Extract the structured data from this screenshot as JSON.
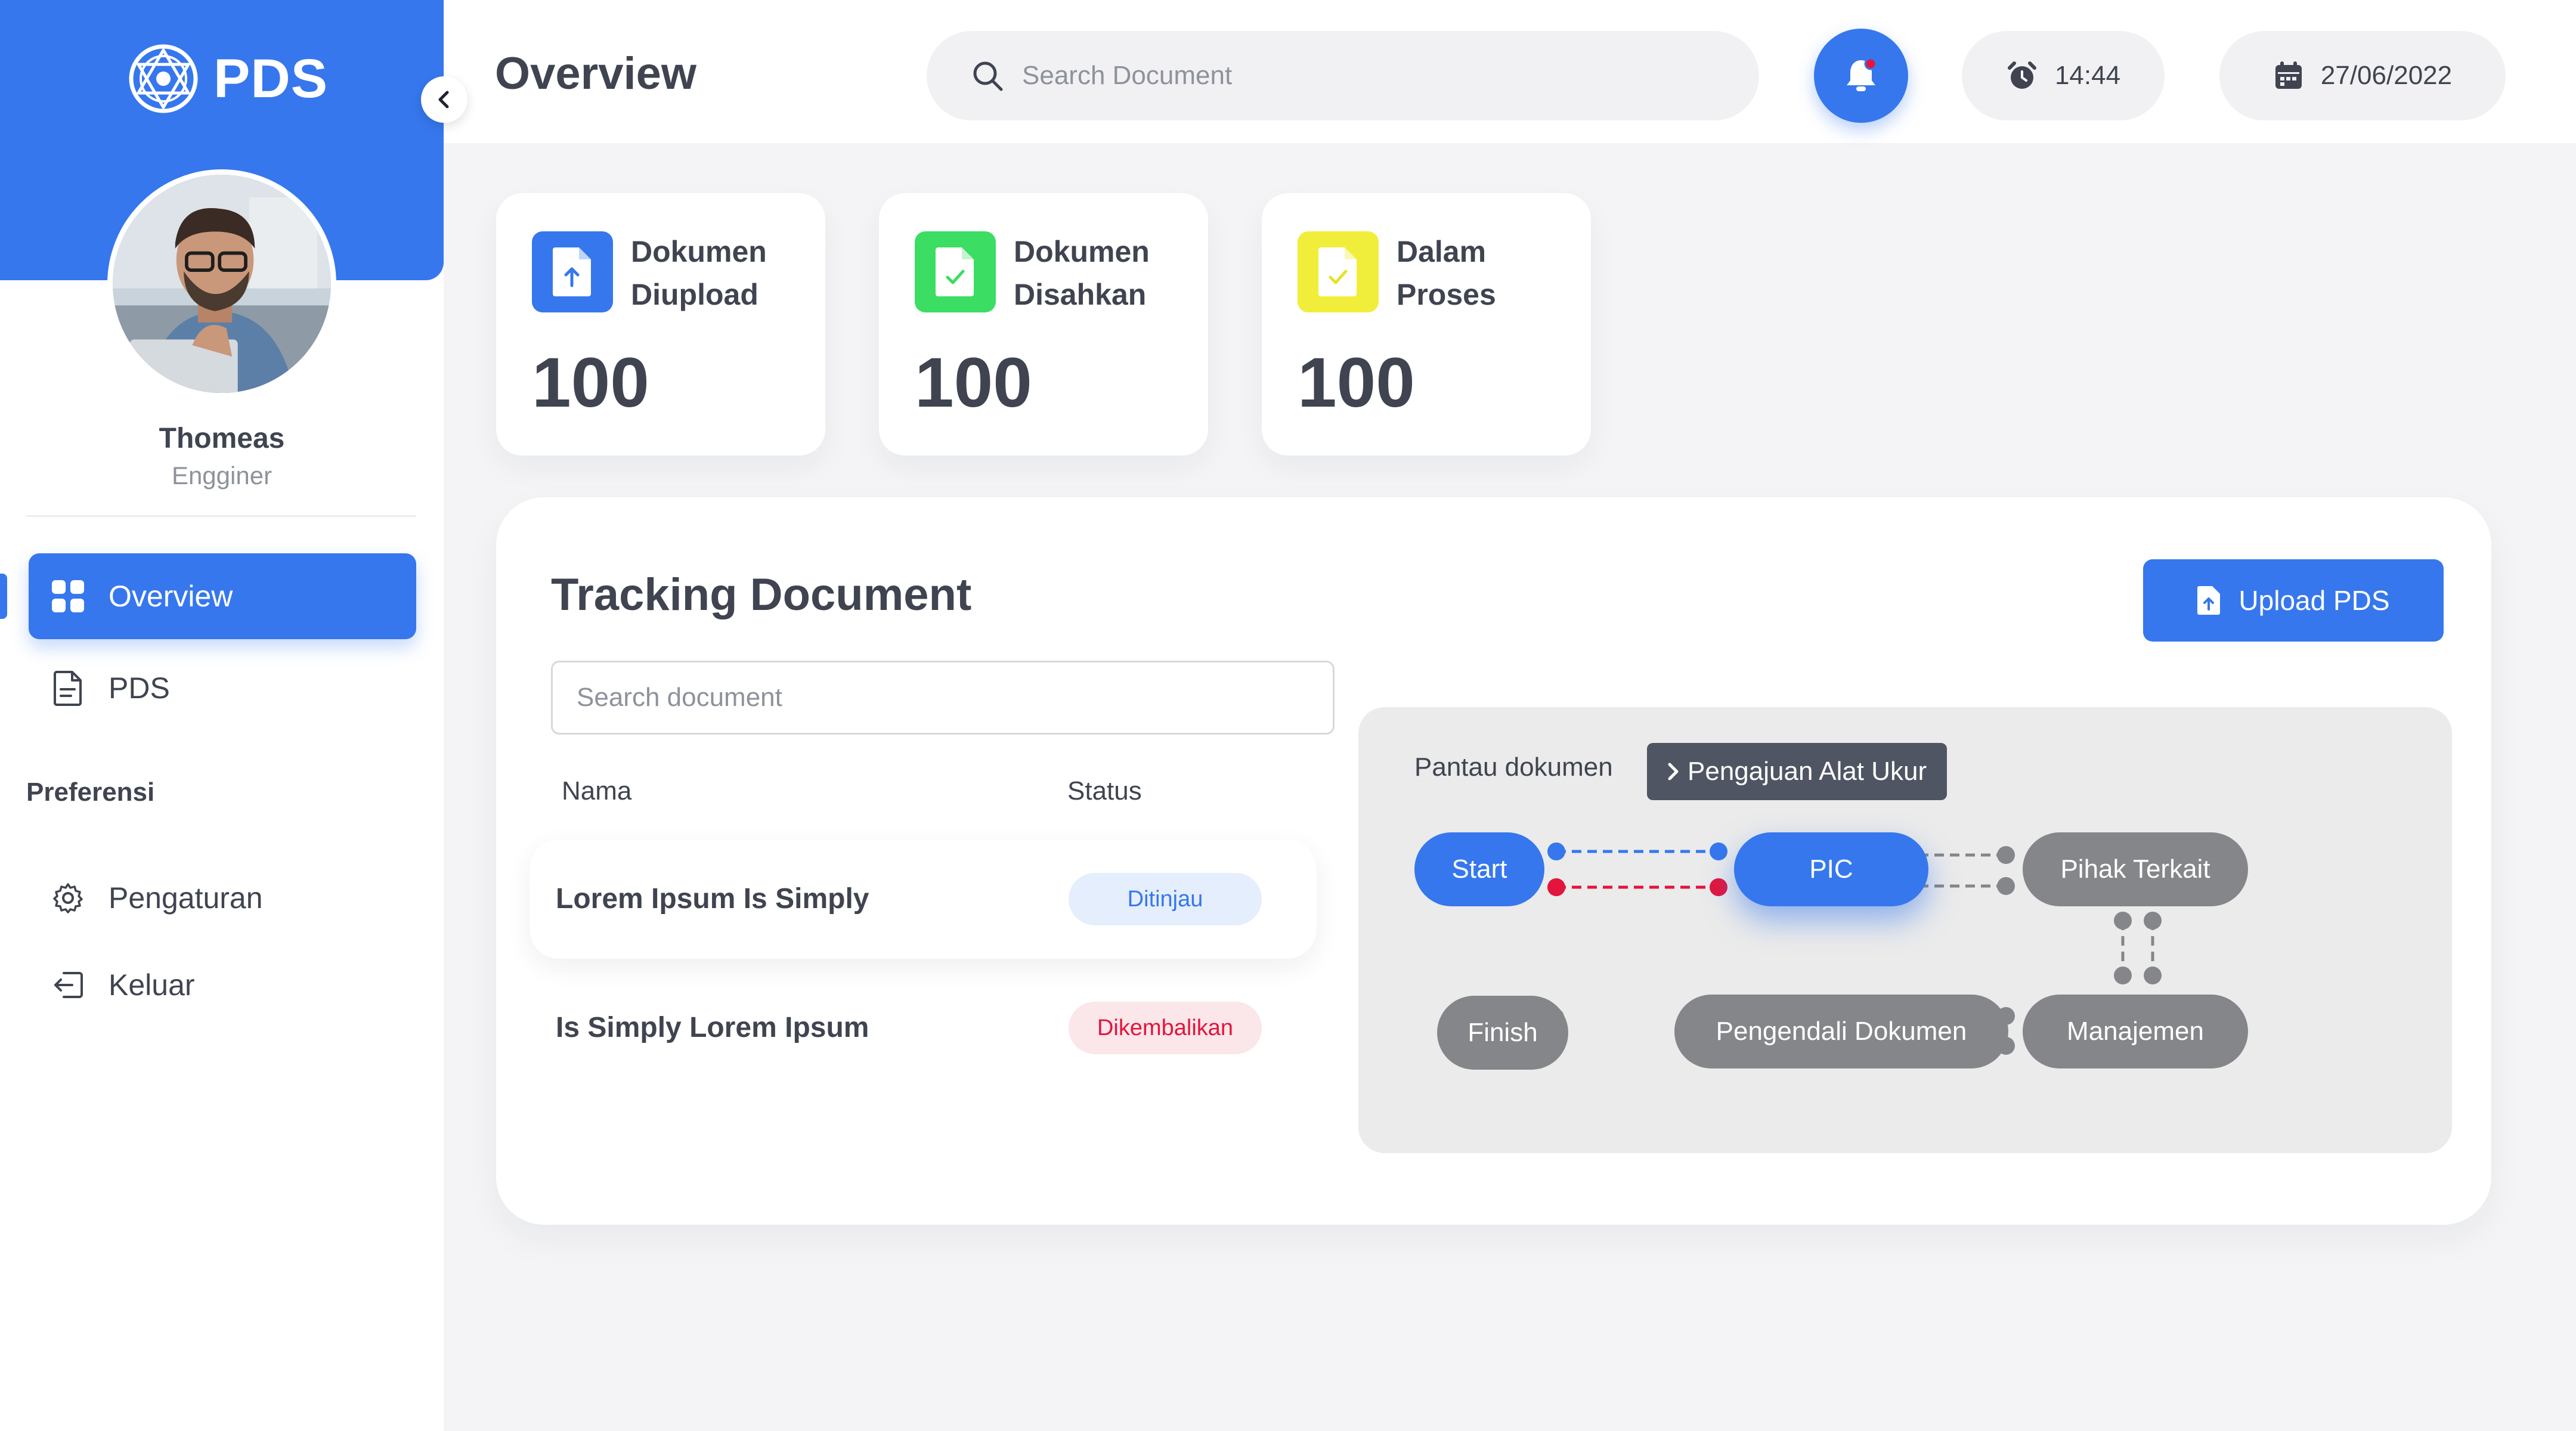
{
  "sidebar": {
    "brand": "PDS",
    "user": {
      "name": "Thomeas",
      "role": "Engginer"
    },
    "nav": [
      {
        "label": "Overview",
        "icon": "grid-icon",
        "active": true
      },
      {
        "label": "PDS",
        "icon": "document-icon",
        "active": false
      }
    ],
    "preferences_title": "Preferensi",
    "preferences": [
      {
        "label": "Pengaturan",
        "icon": "gear-icon"
      },
      {
        "label": "Keluar",
        "icon": "logout-icon"
      }
    ]
  },
  "header": {
    "title": "Overview",
    "search_placeholder": "Search Document",
    "time": "14:44",
    "date": "27/06/2022"
  },
  "stats": [
    {
      "label": "Dokumen Diupload",
      "value": "100",
      "color": "#3677EE",
      "icon": "file-upload-icon"
    },
    {
      "label": "Dokumen Disahkan",
      "value": "100",
      "color": "#3BDD62",
      "icon": "file-check-icon"
    },
    {
      "label": "Dalam Proses",
      "value": "100",
      "color": "#F1EE3B",
      "icon": "file-check-icon"
    }
  ],
  "tracking": {
    "title": "Tracking Document",
    "upload_label": "Upload PDS",
    "search_placeholder": "Search document",
    "columns": {
      "name": "Nama",
      "status": "Status"
    },
    "rows": [
      {
        "name": "Lorem Ipsum Is Simply",
        "status": "Ditinjau"
      },
      {
        "name": "Is Simply Lorem Ipsum",
        "status": "Dikembalikan"
      }
    ],
    "flow": {
      "label": "Pantau dokumen",
      "current": "Pengajuan Alat Ukur",
      "nodes": {
        "start": "Start",
        "pic": "PIC",
        "pihak": "Pihak Terkait",
        "manajemen": "Manajemen",
        "pengendali": "Pengendali Dokumen",
        "finish": "Finish"
      }
    }
  },
  "colors": {
    "accent": "#3677EE",
    "success": "#3BDD62",
    "warning": "#F1EE3B",
    "danger": "#E3153D",
    "node_inactive": "#848689"
  }
}
